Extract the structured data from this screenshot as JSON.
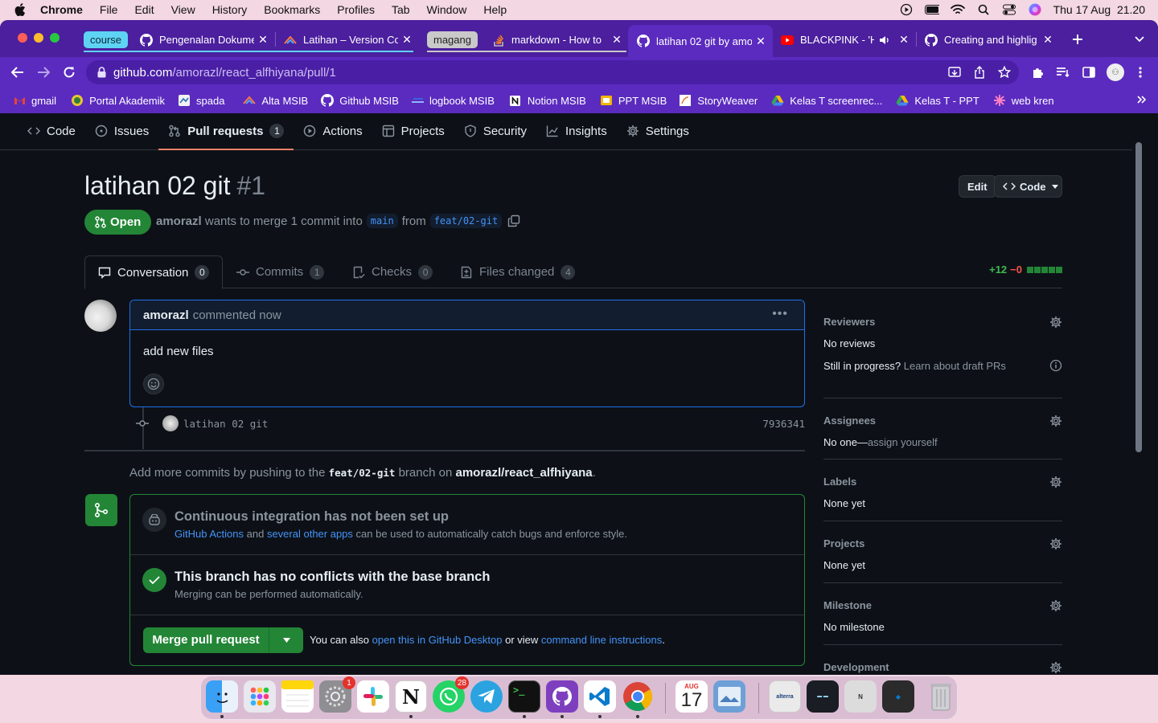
{
  "menubar": {
    "items": [
      "Chrome",
      "File",
      "Edit",
      "View",
      "History",
      "Bookmarks",
      "Profiles",
      "Tab",
      "Window",
      "Help"
    ],
    "clock": "Thu 17 Aug  21.20"
  },
  "tabs": [
    {
      "group": "course",
      "group_color": "#5fd3f3"
    },
    {
      "title": "Pengenalan Dokume",
      "icon": "github-icon"
    },
    {
      "title": "Latihan – Version Co",
      "icon": "alta-icon"
    },
    {
      "group": "magang",
      "group_color": "#c9c9c9"
    },
    {
      "title": "markdown - How to",
      "icon": "stackoverflow-icon"
    },
    {
      "title": "latihan 02 git by amo",
      "icon": "github-icon",
      "active": true
    },
    {
      "title": "BLACKPINK - 'H",
      "icon": "youtube-icon",
      "audio": true
    },
    {
      "title": "Creating and highlig",
      "icon": "github-icon"
    }
  ],
  "address": {
    "host": "github.com",
    "path": "/amorazl/react_alfhiyana/pull/1"
  },
  "bookmarks": [
    {
      "label": "gmail",
      "icon": "gmail-icon"
    },
    {
      "label": "Portal Akademik",
      "icon": "university-icon"
    },
    {
      "label": "spada",
      "icon": "spada-icon"
    },
    {
      "label": "Alta MSIB",
      "icon": "alta-icon"
    },
    {
      "label": "Github MSIB",
      "icon": "github-icon"
    },
    {
      "label": "logbook MSIB",
      "icon": "logbook-icon"
    },
    {
      "label": "Notion MSIB",
      "icon": "notion-icon"
    },
    {
      "label": "PPT MSIB",
      "icon": "slides-icon"
    },
    {
      "label": "StoryWeaver",
      "icon": "storyweaver-icon"
    },
    {
      "label": "Kelas T screenrec...",
      "icon": "drive-icon"
    },
    {
      "label": "Kelas T - PPT",
      "icon": "drive-icon"
    },
    {
      "label": "web kren",
      "icon": "web-icon"
    }
  ],
  "repo_nav": [
    {
      "label": "Code",
      "icon": "code-icon"
    },
    {
      "label": "Issues",
      "icon": "issue-icon"
    },
    {
      "label": "Pull requests",
      "icon": "pull-request-icon",
      "count": "1",
      "selected": true
    },
    {
      "label": "Actions",
      "icon": "play-icon"
    },
    {
      "label": "Projects",
      "icon": "table-icon"
    },
    {
      "label": "Security",
      "icon": "shield-icon"
    },
    {
      "label": "Insights",
      "icon": "graph-icon"
    },
    {
      "label": "Settings",
      "icon": "gear-icon"
    }
  ],
  "pr": {
    "title": "latihan 02 git",
    "number": "#1",
    "edit_label": "Edit",
    "code_label": "Code",
    "state": "Open",
    "author": "amorazl",
    "merge_text": "wants to merge 1 commit into",
    "base": "main",
    "from_text": "from",
    "head": "feat/02-git"
  },
  "pr_tabs": [
    {
      "label": "Conversation",
      "count": "0",
      "icon": "comment-icon",
      "selected": true
    },
    {
      "label": "Commits",
      "count": "1",
      "icon": "commit-icon"
    },
    {
      "label": "Checks",
      "count": "0",
      "icon": "checklist-icon"
    },
    {
      "label": "Files changed",
      "count": "4",
      "icon": "file-diff-icon"
    }
  ],
  "diffstat": {
    "added": "+12",
    "removed": "−0",
    "blocks": 5
  },
  "comment": {
    "author": "amorazl",
    "action": "commented now",
    "body": "add new files"
  },
  "commit": {
    "message": "latihan 02 git",
    "sha": "7936341"
  },
  "add_more": {
    "pre": "Add more commits by pushing to the",
    "branch": "feat/02-git",
    "mid": "branch on",
    "repo": "amorazl/react_alfhiyana",
    "end": "."
  },
  "ci": {
    "title": "Continuous integration has not been set up",
    "link1": "GitHub Actions",
    "and": "and",
    "link2": "several other apps",
    "rest": "can be used to automatically catch bugs and enforce style."
  },
  "conflicts": {
    "title": "This branch has no conflicts with the base branch",
    "sub": "Merging can be performed automatically."
  },
  "merge": {
    "button": "Merge pull request",
    "alt_pre": "You can also",
    "alt_link1": "open this in GitHub Desktop",
    "alt_mid": "or view",
    "alt_link2": "command line instructions",
    "alt_end": "."
  },
  "sidebar": {
    "reviewers": {
      "title": "Reviewers",
      "value": "No reviews",
      "draft_q": "Still in progress?",
      "draft_link": "Learn about draft PRs"
    },
    "assignees": {
      "title": "Assignees",
      "value": "No one—",
      "link": "assign yourself"
    },
    "labels": {
      "title": "Labels",
      "value": "None yet"
    },
    "projects": {
      "title": "Projects",
      "value": "None yet"
    },
    "milestone": {
      "title": "Milestone",
      "value": "No milestone"
    },
    "development": {
      "title": "Development"
    }
  },
  "dock": {
    "apps": [
      "finder-icon",
      "launchpad-icon",
      "notes-icon",
      "system-settings-icon",
      "slack-icon",
      "notion-icon",
      "whatsapp-icon",
      "telegram-icon",
      "terminal-icon",
      "github-desktop-icon",
      "vscode-icon",
      "chrome-icon",
      "calendar-icon",
      "preview-icon"
    ],
    "settings_badge": "1",
    "whatsapp_badge": "28",
    "calendar_month": "AUG",
    "calendar_day": "17"
  },
  "colors": {
    "accent": "#238636",
    "link": "#4493f8",
    "tab_bar": "#4b1f9e",
    "toolbar": "#5b2bbf",
    "selected_underline": "#f78166"
  }
}
